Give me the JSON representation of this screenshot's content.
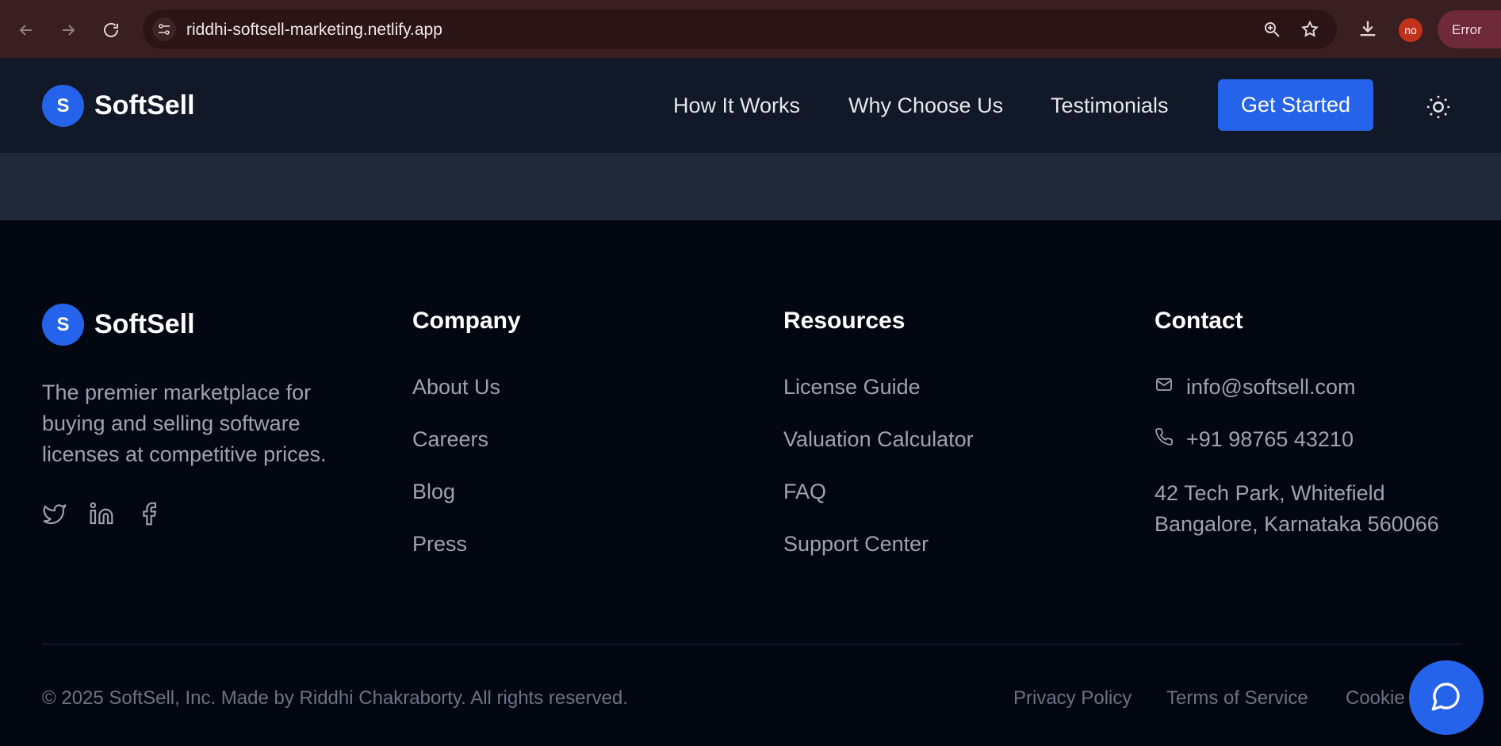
{
  "browser": {
    "url": "riddhi-softsell-marketing.netlify.app",
    "profile_initials": "no",
    "error_label": "Error"
  },
  "header": {
    "logo_letter": "S",
    "brand": "SoftSell",
    "nav": [
      "How It Works",
      "Why Choose Us",
      "Testimonials"
    ],
    "cta": "Get Started"
  },
  "footer": {
    "logo_letter": "S",
    "brand": "SoftSell",
    "tagline_lines": [
      "The premier marketplace for",
      "buying and selling software",
      "licenses at competitive prices."
    ],
    "company": {
      "title": "Company",
      "links": [
        "About Us",
        "Careers",
        "Blog",
        "Press"
      ]
    },
    "resources": {
      "title": "Resources",
      "links": [
        "License Guide",
        "Valuation Calculator",
        "FAQ",
        "Support Center"
      ]
    },
    "contact": {
      "title": "Contact",
      "email": "info@softsell.com",
      "phone": "+91 98765 43210",
      "address_line1": "42 Tech Park, Whitefield",
      "address_line2": "Bangalore, Karnataka 560066"
    },
    "copyright": "© 2025 SoftSell, Inc. Made by Riddhi Chakraborty. All rights reserved.",
    "legal": [
      "Privacy Policy",
      "Terms of Service",
      "Cookie"
    ]
  },
  "colors": {
    "accent": "#2563eb",
    "header_bg": "#111827",
    "footer_bg": "#030712",
    "chrome_bg": "#3a1f22"
  }
}
